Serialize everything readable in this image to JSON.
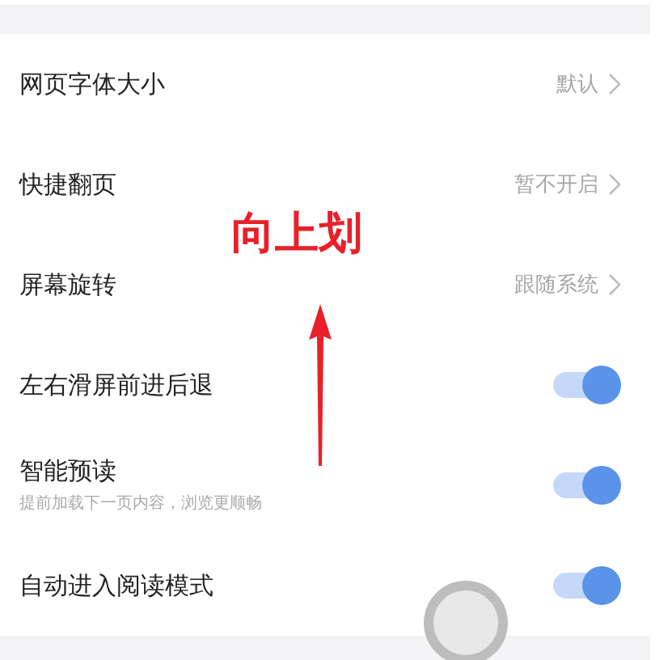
{
  "settings": [
    {
      "kind": "link",
      "label": "网页字体大小",
      "value": "默认"
    },
    {
      "kind": "link",
      "label": "快捷翻页",
      "value": "暂不开启"
    },
    {
      "kind": "link",
      "label": "屏幕旋转",
      "value": "跟随系统"
    },
    {
      "kind": "toggle",
      "label": "左右滑屏前进后退",
      "on": true
    },
    {
      "kind": "toggle",
      "label": "智能预读",
      "subtitle": "提前加载下一页内容，浏览更顺畅",
      "on": true
    },
    {
      "kind": "toggle",
      "label": "自动进入阅读模式",
      "on": true
    }
  ],
  "annotation": {
    "text": "向上划"
  }
}
